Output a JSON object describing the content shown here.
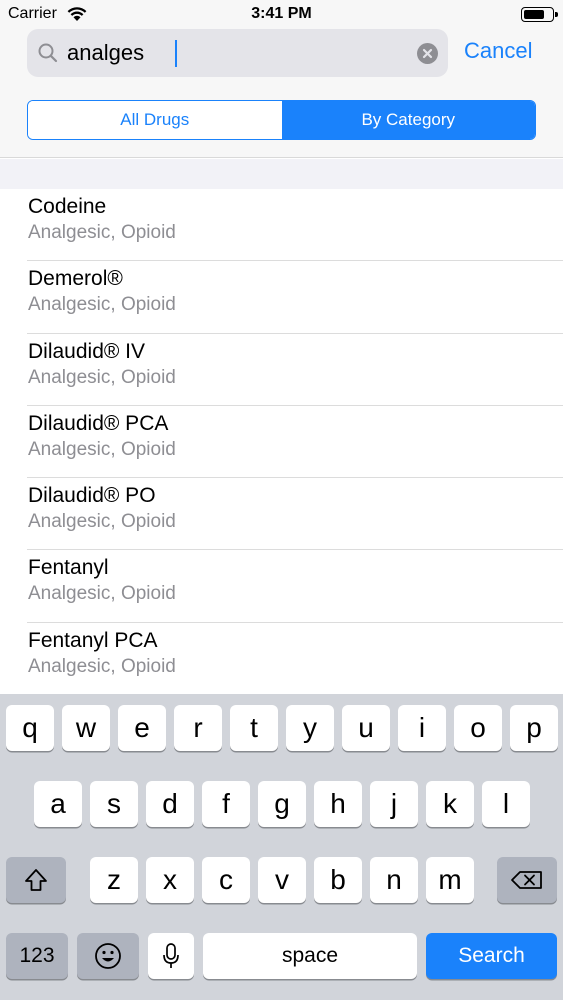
{
  "status_bar": {
    "carrier": "Carrier",
    "time": "3:41 PM",
    "battery_level": 0.75
  },
  "search": {
    "query": "analges",
    "cancel_label": "Cancel",
    "icons": {
      "search": "search-icon",
      "clear": "clear-icon"
    }
  },
  "segments": [
    {
      "label": "All Drugs",
      "selected": false
    },
    {
      "label": "By Category",
      "selected": true
    }
  ],
  "results": [
    {
      "title": "Codeine",
      "subtitle": "Analgesic, Opioid"
    },
    {
      "title": "Demerol®",
      "subtitle": "Analgesic, Opioid"
    },
    {
      "title": "Dilaudid® IV",
      "subtitle": "Analgesic, Opioid"
    },
    {
      "title": "Dilaudid® PCA",
      "subtitle": "Analgesic, Opioid"
    },
    {
      "title": "Dilaudid® PO",
      "subtitle": "Analgesic, Opioid"
    },
    {
      "title": "Fentanyl",
      "subtitle": "Analgesic, Opioid"
    },
    {
      "title": "Fentanyl PCA",
      "subtitle": "Analgesic, Opioid"
    }
  ],
  "keyboard": {
    "row1": [
      "q",
      "w",
      "e",
      "r",
      "t",
      "y",
      "u",
      "i",
      "o",
      "p"
    ],
    "row2": [
      "a",
      "s",
      "d",
      "f",
      "g",
      "h",
      "j",
      "k",
      "l"
    ],
    "row3": [
      "z",
      "x",
      "c",
      "v",
      "b",
      "n",
      "m"
    ],
    "numbers_label": "123",
    "space_label": "space",
    "search_label": "Search",
    "icons": {
      "shift": "shift-icon",
      "delete": "delete-icon",
      "emoji": "emoji-icon",
      "dictation": "microphone-icon"
    }
  },
  "colors": {
    "accent": "#1a82fb",
    "secondary_text": "#8e8e93",
    "keyboard_bg": "#d1d4da"
  }
}
